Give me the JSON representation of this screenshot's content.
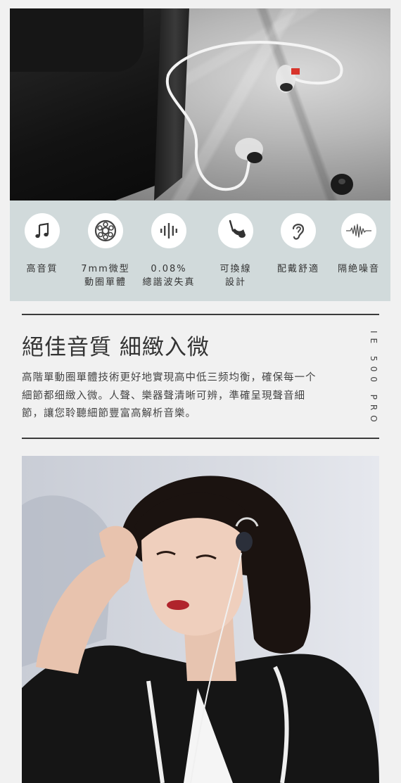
{
  "hero_image": {
    "alt": "IE 500 PRO earphones with clear cable on marble next to carrying case"
  },
  "features": [
    {
      "icon": "music-note-icon",
      "label": "高音質"
    },
    {
      "icon": "driver-coil-icon",
      "label": "7mm微型\n動圈單體"
    },
    {
      "icon": "waveform-bars-icon",
      "label": "0.08%\n總諧波失真"
    },
    {
      "icon": "detachable-cable-icon",
      "label": "可換線\n設計"
    },
    {
      "icon": "ear-icon",
      "label": "配戴舒適"
    },
    {
      "icon": "noise-isolation-icon",
      "label": "隔絶噪音"
    }
  ],
  "section": {
    "headline": "絕佳音質 細緻入微",
    "body": "高階單動圈單體技術更好地實現高中低三频均衡，確保每一个細節都细緻入微。人聲、樂器聲清晰可辨，準確呈現聲音細節，讓您聆聽細節豐富高解析音樂。",
    "model": "IE 500 PRO"
  },
  "portrait_image": {
    "alt": "Woman wearing IE 500 PRO in-ear monitors"
  },
  "colors": {
    "page_bg": "#f1f1f1",
    "feature_band": "#d1dadb",
    "icon_circle": "#ffffff",
    "text": "#333333"
  }
}
